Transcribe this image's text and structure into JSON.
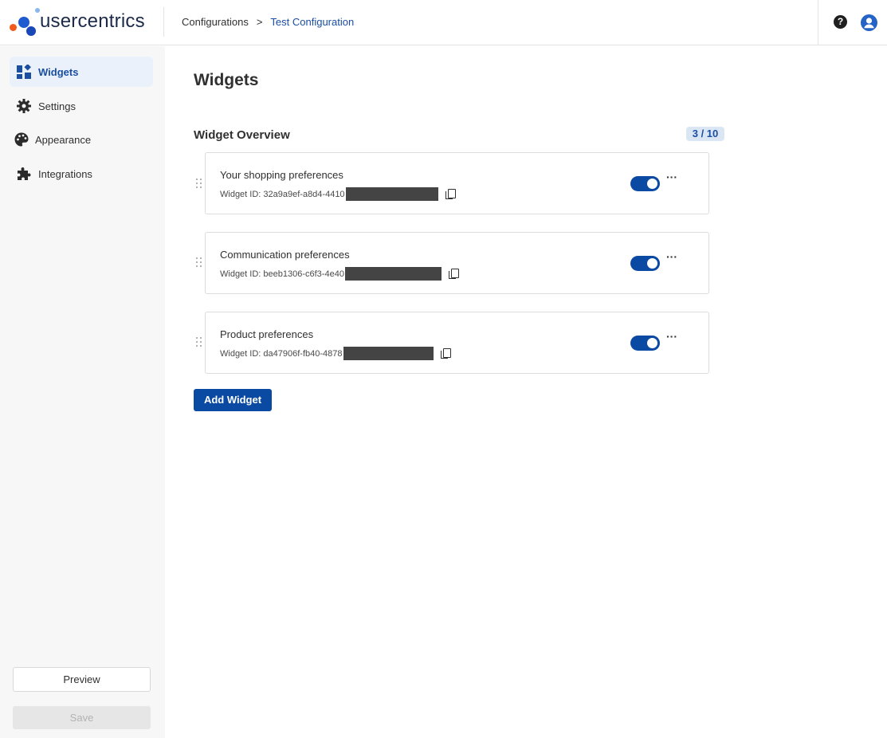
{
  "brand": {
    "name": "usercentrics",
    "colors": {
      "orange": "#f25a1c",
      "blue": "#1e5bd0",
      "light_blue": "#8ab6ee",
      "dark_text": "#1b2a4a"
    }
  },
  "breadcrumb": {
    "parent": "Configurations",
    "separator": ">",
    "current": "Test Configuration"
  },
  "header_icons": {
    "help": "question-circle-icon",
    "user": "user-circle-icon"
  },
  "sidebar": {
    "items": [
      {
        "label": "Widgets",
        "icon": "widgets-icon",
        "active": true
      },
      {
        "label": "Settings",
        "icon": "gear-icon",
        "active": false
      },
      {
        "label": "Appearance",
        "icon": "palette-icon",
        "active": false
      },
      {
        "label": "Integrations",
        "icon": "puzzle-icon",
        "active": false
      }
    ],
    "preview_label": "Preview",
    "save_label": "Save"
  },
  "main": {
    "title": "Widgets",
    "overview_title": "Widget Overview",
    "count_badge": "3 / 10",
    "widgets": [
      {
        "name": "Your shopping preferences",
        "id_label": "Widget ID: 32a9a9ef-a8d4-4410",
        "enabled": true,
        "more": "···"
      },
      {
        "name": "Communication preferences",
        "id_label": "Widget ID: beeb1306-c6f3-4e40",
        "enabled": true,
        "more": "···"
      },
      {
        "name": "Product preferences",
        "id_label": "Widget ID: da47906f-fb40-4878",
        "enabled": true,
        "more": "···"
      }
    ],
    "add_button_label": "Add Widget"
  },
  "accent_color": "#0b4aa2"
}
